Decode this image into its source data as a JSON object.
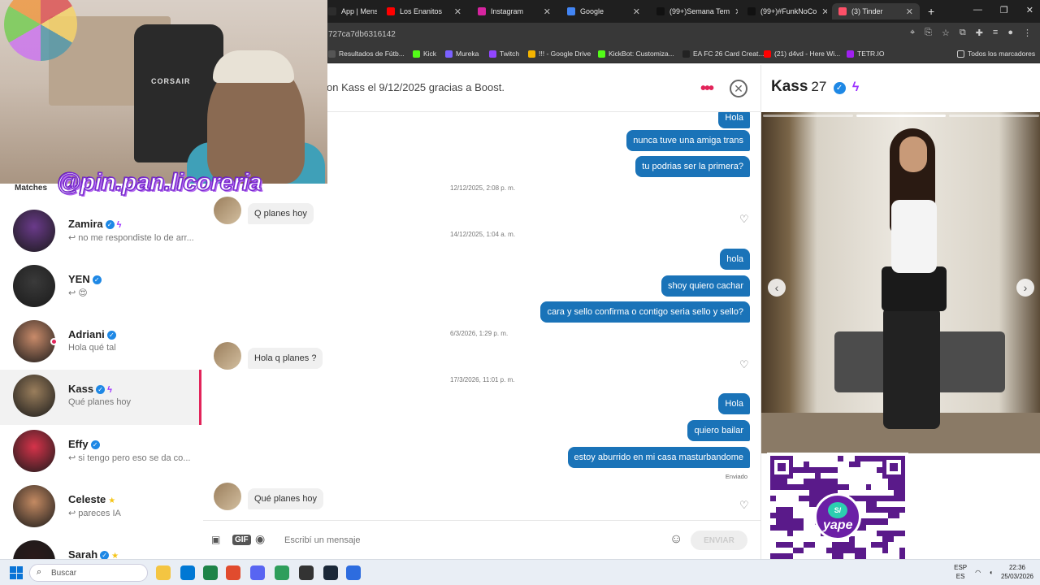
{
  "browser": {
    "tabs": [
      {
        "label": "App | Mens",
        "color": "#2d2d2d",
        "active": false
      },
      {
        "label": "Los Enanitos",
        "color": "#ff0000",
        "active": false
      },
      {
        "label": "Instagram",
        "color": "#d6249f",
        "active": false
      },
      {
        "label": "Google",
        "color": "#4285f4",
        "active": false
      },
      {
        "label": "(99+)Semana Tem",
        "color": "#111111",
        "active": false
      },
      {
        "label": "(99+)#FunkNoCo",
        "color": "#111111",
        "active": false
      },
      {
        "label": "(3) Tinder",
        "color": "#fd5068",
        "active": true
      }
    ],
    "url": "727ca7db6316142",
    "bookmarks": [
      {
        "label": "Resultados de Fútb...",
        "color": "#555555"
      },
      {
        "label": "Kick",
        "color": "#53fc18"
      },
      {
        "label": "Mureka",
        "color": "#7b61ff"
      },
      {
        "label": "Twitch",
        "color": "#9146ff"
      },
      {
        "label": "!!! - Google Drive",
        "color": "#f4b400"
      },
      {
        "label": "KickBot: Customiza...",
        "color": "#53fc18"
      },
      {
        "label": "EA FC 26 Card Creat...",
        "color": "#222222"
      },
      {
        "label": "(21) d4vd - Here Wi...",
        "color": "#ff0000"
      },
      {
        "label": "TETR.IO",
        "color": "#a020f0"
      }
    ],
    "all_bookmarks": "Todos los marcadores"
  },
  "overlay": {
    "handle": "@pin.pan.licoreria",
    "chair_brand": "CORSAIR"
  },
  "sidebar": {
    "section_label": "Matches",
    "matches": [
      {
        "name": "Zamira",
        "preview": "↩ no me respondiste lo de arr...",
        "verified": true,
        "badge": "bolt",
        "avatar": "#6a3a8a"
      },
      {
        "name": "YEN",
        "preview": "↩ 😍",
        "verified": true,
        "badge": "",
        "avatar": "#3a3a3a"
      },
      {
        "name": "Adriani",
        "preview": "Hola qué tal",
        "verified": true,
        "badge": "",
        "avatar": "#c98b6a",
        "online": true
      },
      {
        "name": "Kass",
        "preview": "Qué planes hoy",
        "verified": true,
        "badge": "bolt",
        "avatar": "#9a7e5c",
        "active": true
      },
      {
        "name": "Effy",
        "preview": "↩ si tengo pero eso se da co...",
        "verified": true,
        "badge": "",
        "avatar": "#d6334a"
      },
      {
        "name": "Celeste",
        "preview": "↩ pareces IA",
        "verified": false,
        "badge": "star",
        "avatar": "#c48a62"
      },
      {
        "name": "Sarah",
        "preview": "",
        "verified": true,
        "badge": "star",
        "avatar": "#2a1a1a"
      }
    ]
  },
  "chat": {
    "match_notice": "on Kass el 9/12/2025 gracias a Boost.",
    "messages": [
      {
        "type": "out",
        "text": "Hola"
      },
      {
        "type": "out",
        "text": "nunca tuve una amiga trans"
      },
      {
        "type": "out",
        "text": "tu podrias ser la primera?"
      },
      {
        "type": "ts",
        "text": "12/12/2025, 2:08 p. m."
      },
      {
        "type": "in",
        "text": "Q planes hoy"
      },
      {
        "type": "ts",
        "text": "14/12/2025, 1:04 a. m."
      },
      {
        "type": "out",
        "text": "hola"
      },
      {
        "type": "out",
        "text": "shoy quiero cachar"
      },
      {
        "type": "out",
        "text": "cara y sello confirma o contigo seria sello y sello?"
      },
      {
        "type": "ts",
        "text": "6/3/2026, 1:29 p. m."
      },
      {
        "type": "in",
        "text": "Hola q planes ?"
      },
      {
        "type": "ts",
        "text": "17/3/2026, 11:01 p. m."
      },
      {
        "type": "out",
        "text": "Hola"
      },
      {
        "type": "out",
        "text": "quiero bailar"
      },
      {
        "type": "out",
        "text": "estoy aburrido en mi casa masturbandome"
      },
      {
        "type": "in",
        "text": "Qué planes hoy"
      }
    ],
    "sent_label": "Enviado",
    "compose": {
      "placeholder": "Escribí un mensaje",
      "gif_label": "GIF",
      "send_label": "ENVIAR"
    }
  },
  "profile": {
    "name": "Kass",
    "age": "27",
    "verified": true,
    "photo_count": 3,
    "photo_index": 1
  },
  "qr": {
    "brand": "yape",
    "logo_text": "S/"
  },
  "taskbar": {
    "search_label": "Buscar",
    "apps": [
      "#f4c542",
      "#0078d4",
      "#1d8348",
      "#e14b2e",
      "#5865f2",
      "#2e9e5b",
      "#333333",
      "#1b2838",
      "#2d6cdf"
    ],
    "lang_top": "ESP",
    "lang_bottom": "ES",
    "time": "22:36",
    "date": "25/03/2026"
  }
}
